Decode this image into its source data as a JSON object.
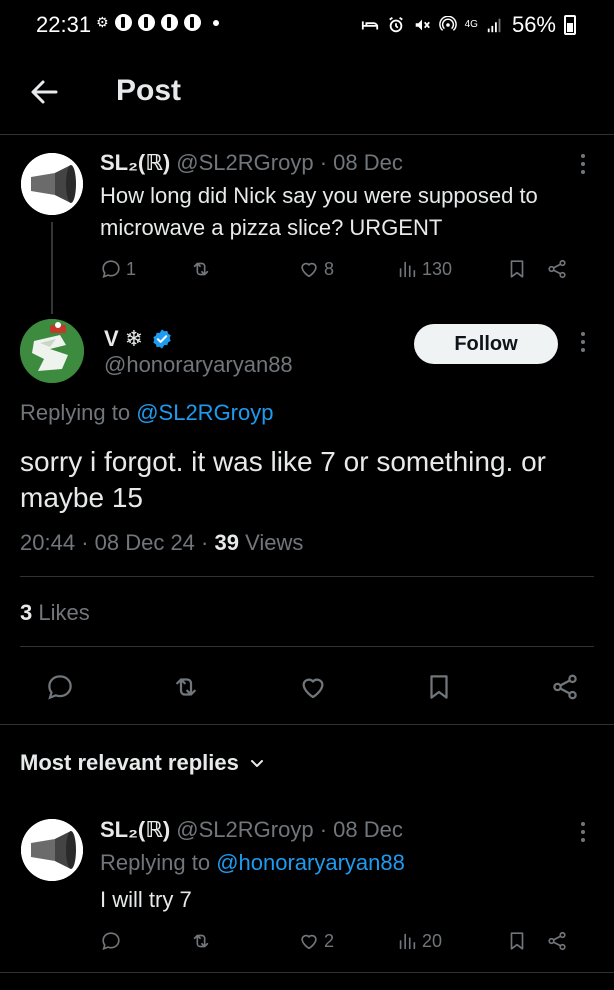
{
  "status_bar": {
    "time": "22:31",
    "battery": "56%",
    "network": "4G"
  },
  "header": {
    "title": "Post",
    "back_icon": "arrow-left-icon"
  },
  "parent_post": {
    "display_name": "SL₂(ℝ)",
    "handle": "@SL2RGroyp",
    "date": "· 08 Dec",
    "text": "How long did Nick say you were supposed to microwave a pizza slice? URGENT",
    "replies": "1",
    "reposts": "",
    "likes": "8",
    "views": "130"
  },
  "main_post": {
    "display_name": "V ❄",
    "handle": "@honoraryaryan88",
    "follow_label": "Follow",
    "replying_prefix": "Replying to",
    "replying_to": "@SL2RGroyp",
    "text": "sorry i forgot. it was like 7 or something. or maybe 15",
    "time": "20:44",
    "date": "· 08 Dec 24 ·",
    "views_count": "39",
    "views_label": "Views",
    "likes_count": "3",
    "likes_label": "Likes"
  },
  "replies_section": {
    "sort_label": "Most relevant replies"
  },
  "reply": {
    "display_name": "SL₂(ℝ)",
    "handle": "@SL2RGroyp",
    "date": "· 08 Dec",
    "replying_prefix": "Replying to",
    "replying_to": "@honoraryaryan88",
    "text": "I will try 7",
    "replies": "",
    "reposts": "",
    "likes": "2",
    "views": "20"
  },
  "colors": {
    "background": "#000000",
    "text": "#e7e9ea",
    "secondary": "#71767b",
    "accent": "#1d9bf0",
    "divider": "#2f3336"
  }
}
